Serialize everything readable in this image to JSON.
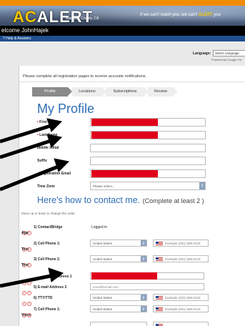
{
  "banner": {
    "logo_ac": "AC",
    "logo_alert": "ALERT",
    "county": "Alameda County, CA",
    "tagline_pre": "If we can't reach you, we can't ",
    "tagline_alert": "ALERT",
    "tagline_post": " you"
  },
  "welcome_text": "elcome JohnHajek",
  "help_text": "? Help & Answers",
  "language": {
    "label": "Language:",
    "selected": "Select Language",
    "powered_by": "Powered by Google Tra"
  },
  "notice": "Please complete all registration pages to receive accurate notifications.",
  "steps": [
    "Profile",
    "Locations",
    "Subscriptions",
    "Review"
  ],
  "profile_title": "My Profile",
  "fields": {
    "first_name": "First N",
    "last_name": "Last Name",
    "middle_initial": "Middle Initial",
    "suffix": "Suffix",
    "registration_email": "Registration Email",
    "time_zone": "Time Zone",
    "time_zone_value": "Please select..."
  },
  "contact": {
    "title": "Here's how to contact me.",
    "subtitle": "(Complete at least 2 )",
    "move_hint": "Move up or down to change the order.",
    "rows": [
      {
        "label": "1) ContactBridge",
        "sub": "App",
        "status": "Logged in"
      },
      {
        "label": "2) Cell Phone 1:",
        "sub": "Text",
        "country": "United States",
        "phone_placeholder": "Example (201) 555-0123"
      },
      {
        "label": "3) Cell Phone 2:",
        "sub": "Text",
        "country": "United States",
        "phone_placeholder": "Example (201) 555-0123"
      },
      {
        "label": "ddress 1"
      },
      {
        "label": "5) E-mail Address 2",
        "email_placeholder": "email@email.com"
      },
      {
        "label": "6) TTY/TTD",
        "country": "United States",
        "phone_placeholder": "Example (201) 555-0123"
      },
      {
        "label": "7) Cell Phone 1:",
        "sub": "Voice",
        "country": "United States",
        "phone_placeholder": "Example (201) 555-0123"
      }
    ]
  },
  "colors": {
    "accent_blue": "#2f6db3",
    "redaction": "#e0001b",
    "brand_orange": "#f08c00"
  }
}
